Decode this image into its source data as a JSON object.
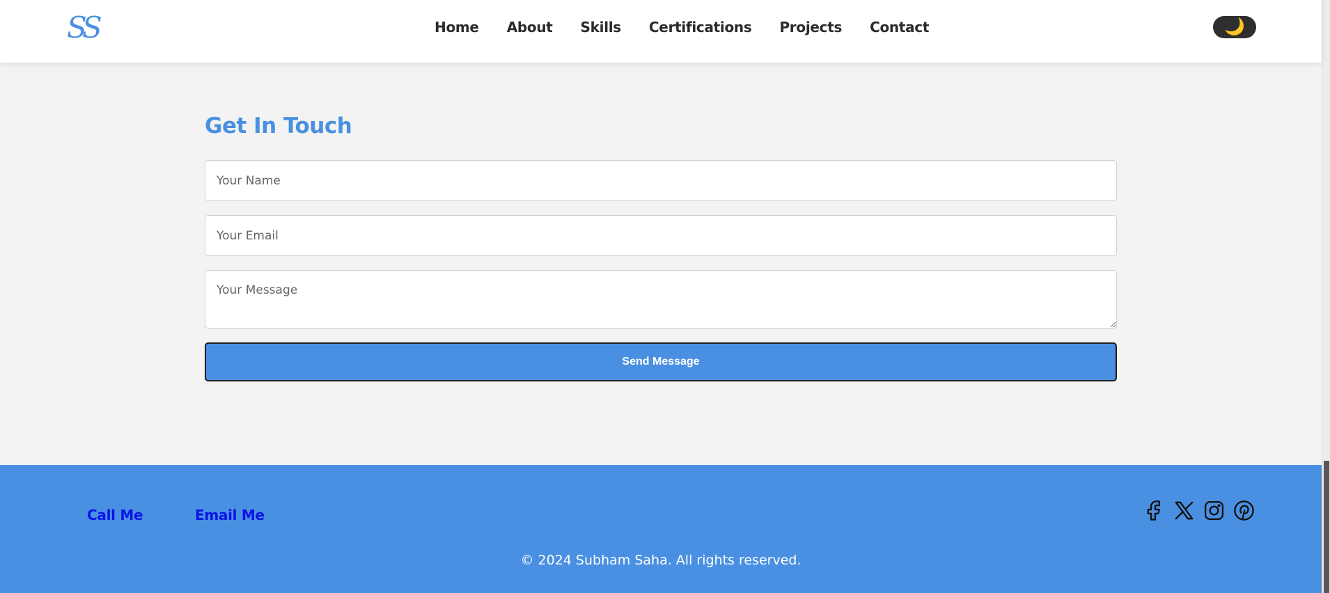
{
  "header": {
    "logo_text": "SS",
    "nav": [
      {
        "label": "Home"
      },
      {
        "label": "About"
      },
      {
        "label": "Skills"
      },
      {
        "label": "Certifications"
      },
      {
        "label": "Projects"
      },
      {
        "label": "Contact"
      }
    ],
    "theme_toggle": {
      "icon": "moon-icon",
      "glyph": "🌙"
    }
  },
  "contact": {
    "title": "Get In Touch",
    "name_placeholder": "Your Name",
    "email_placeholder": "Your Email",
    "message_placeholder": "Your Message",
    "send_label": "Send Message"
  },
  "footer": {
    "call_label": "Call Me",
    "email_label": "Email Me",
    "social_icons": [
      "facebook-icon",
      "x-icon",
      "instagram-icon",
      "pinterest-icon"
    ],
    "copyright": "© 2024 Subham Saha. All rights reserved."
  },
  "colors": {
    "accent": "#4a90e2",
    "footer_link": "#0b14e6",
    "background": "#f3f3f3",
    "header_bg": "#ffffff",
    "toggle_bg": "#2f2f2f"
  }
}
